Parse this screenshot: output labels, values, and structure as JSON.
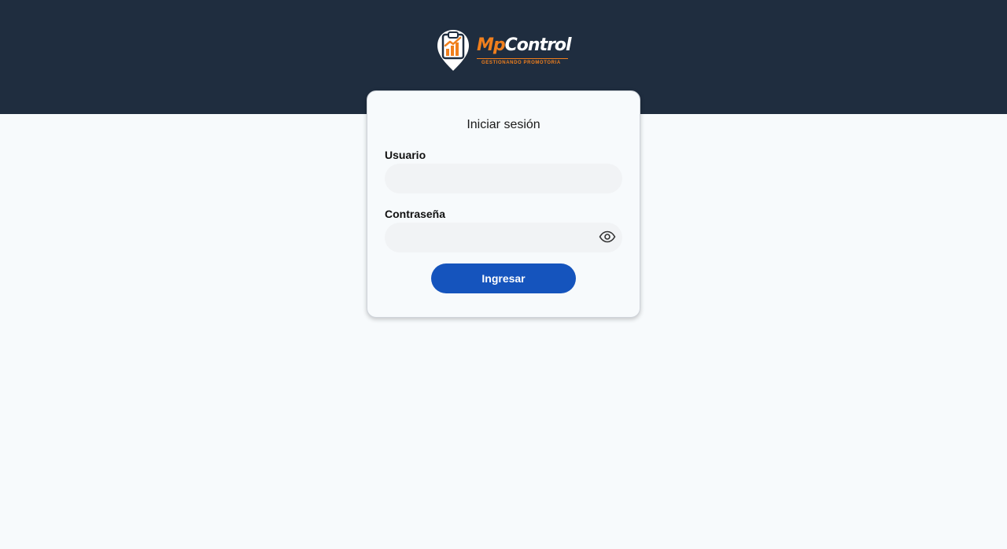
{
  "brand": {
    "name_part1": "Mp",
    "name_part2": "Control",
    "tagline": "GESTIONANDO PROMOTORIA",
    "colors": {
      "header_bg": "#1f2d3f",
      "accent": "#f07f1d",
      "primary": "#1554bd"
    },
    "logo_icon": "clipboard-map-pin-chart-icon"
  },
  "login": {
    "title": "Iniciar sesión",
    "username": {
      "label": "Usuario",
      "value": "",
      "placeholder": ""
    },
    "password": {
      "label": "Contraseña",
      "value": "",
      "placeholder": "",
      "toggle_icon": "eye-icon"
    },
    "submit_label": "Ingresar"
  }
}
